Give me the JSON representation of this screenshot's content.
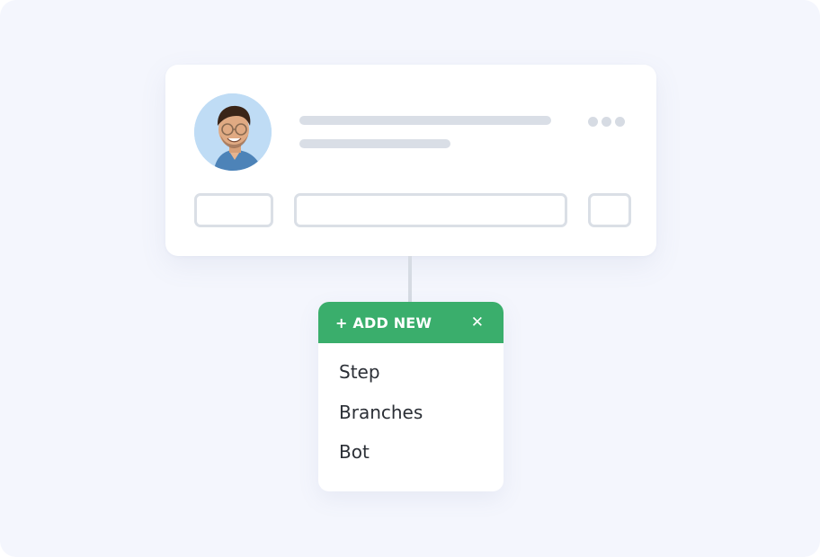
{
  "card": {
    "avatar_icon": "person-avatar",
    "more_icon": "ellipsis-icon"
  },
  "add_menu": {
    "title": "+ ADD NEW",
    "close_icon": "close-icon",
    "close_glyph": "✕",
    "items": [
      {
        "label": "Step"
      },
      {
        "label": "Branches"
      },
      {
        "label": "Bot"
      }
    ]
  },
  "colors": {
    "background": "#f4f6fd",
    "accent": "#3aae6c",
    "skeleton": "#d9dee6",
    "text": "#2b2f36"
  }
}
